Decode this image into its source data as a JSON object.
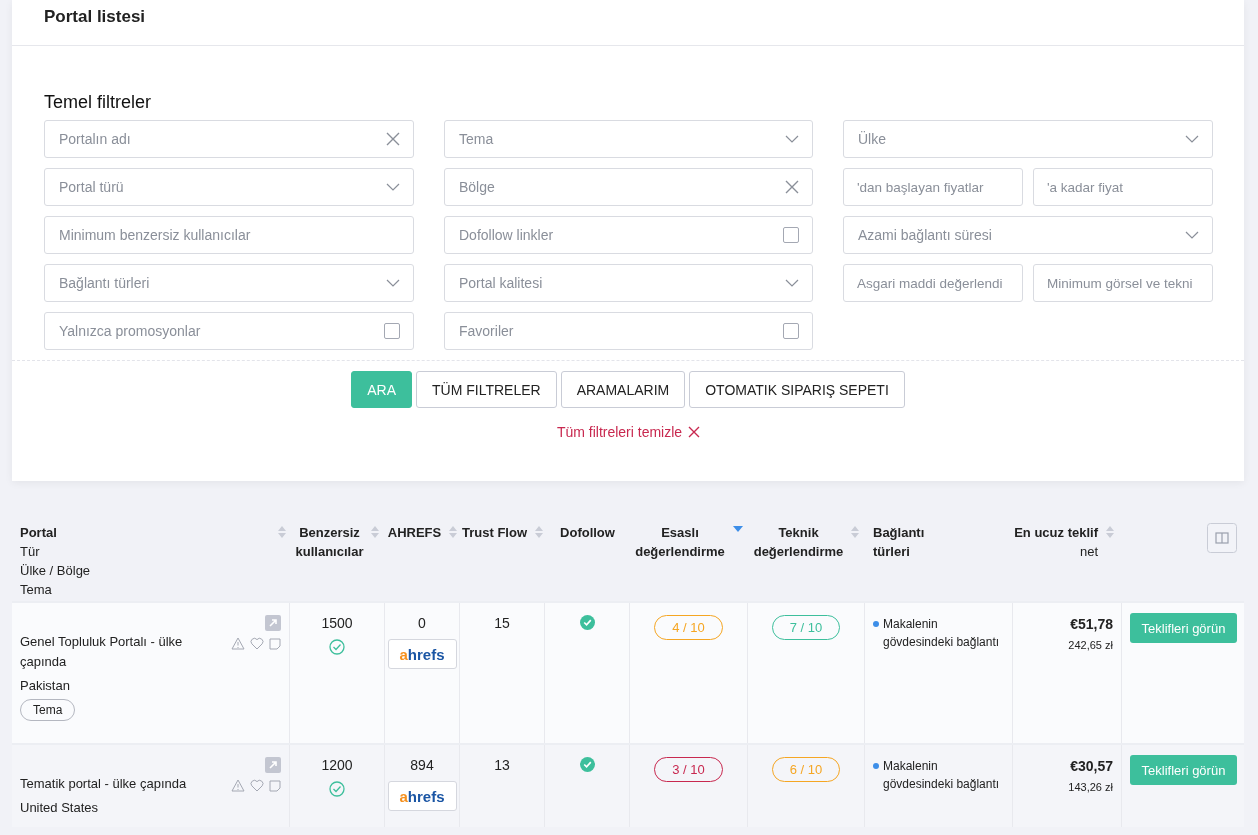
{
  "page_title": "Portal listesi",
  "filters": {
    "title": "Temel filtreler",
    "fields": [
      {
        "kind": "clear",
        "placeholder": "Portalın adı"
      },
      {
        "kind": "select",
        "placeholder": "Tema"
      },
      {
        "kind": "select",
        "placeholder": "Ülke"
      },
      {
        "kind": "select",
        "placeholder": "Portal türü"
      },
      {
        "kind": "clear",
        "placeholder": "Bölge"
      },
      {
        "kind": "pair",
        "fields": [
          {
            "placeholder": "'dan başlayan fiyatlar"
          },
          {
            "placeholder": "'a kadar fiyat"
          }
        ]
      },
      {
        "kind": "text",
        "placeholder": "Minimum benzersiz kullanıcılar"
      },
      {
        "kind": "check",
        "placeholder": "Dofollow linkler",
        "checked": false
      },
      {
        "kind": "select",
        "placeholder": "Azami bağlantı süresi"
      },
      {
        "kind": "select",
        "placeholder": "Bağlantı türleri"
      },
      {
        "kind": "select",
        "placeholder": "Portal kalitesi"
      },
      {
        "kind": "pair",
        "fields": [
          {
            "placeholder": "Asgari maddi değerlendi"
          },
          {
            "placeholder": "Minimum görsel ve tekni"
          }
        ]
      },
      {
        "kind": "check",
        "placeholder": "Yalnızca promosyonlar",
        "checked": false
      },
      {
        "kind": "check",
        "placeholder": "Favoriler",
        "checked": false
      }
    ],
    "buttons": [
      {
        "label": "ARA",
        "primary": true
      },
      {
        "label": "TÜM FILTRELER",
        "primary": false
      },
      {
        "label": "ARAMALARIM",
        "primary": false
      },
      {
        "label": "OTOMATIK SIPARIŞ SEPETI",
        "primary": false
      }
    ],
    "clear_link": "Tüm filtreleri temizle"
  },
  "table": {
    "columns": [
      {
        "lines": [
          "Portal",
          "Tür",
          "Ülke / Bölge",
          "Tema"
        ],
        "sortable": true,
        "sorted": false
      },
      {
        "lines": [
          "Benzersiz",
          "kullanıcılar"
        ],
        "sortable": true,
        "sorted": false
      },
      {
        "lines": [
          "AHREFS"
        ],
        "sortable": true,
        "sorted": false
      },
      {
        "lines": [
          "Trust Flow"
        ],
        "sortable": true,
        "sorted": false
      },
      {
        "lines": [
          "Dofollow"
        ],
        "sortable": false
      },
      {
        "lines": [
          "Esaslı",
          "değerlendirme"
        ],
        "sortable": true,
        "sorted": true
      },
      {
        "lines": [
          "Teknik",
          "değerlendirme"
        ],
        "sortable": true,
        "sorted": false
      },
      {
        "lines": [
          "Bağlantı",
          "türleri"
        ],
        "sortable": false
      },
      {
        "lines": [
          "En ucuz teklif",
          "net"
        ],
        "sortable": true,
        "sorted": false
      }
    ],
    "rows": [
      {
        "portal": "Genel Topluluk Portalı - ülke çapında",
        "country": "Pakistan",
        "tag": "Tema",
        "unique_users": "1500",
        "verified": true,
        "ahrefs": "0",
        "ahrefs_logo": "ahrefs",
        "trust_flow": "15",
        "dofollow": true,
        "scores": [
          {
            "text": "4 / 10",
            "color": "#f5a623"
          },
          {
            "text": "7 / 10",
            "color": "#3dbf9c"
          }
        ],
        "link_type": "Makalenin gövdesindeki bağlantı",
        "price": "€51,78",
        "price_local": "242,65 zł",
        "action": "Teklifleri görün"
      },
      {
        "portal": "Tematik portal - ülke çapında",
        "country": "United States",
        "unique_users": "1200",
        "verified": true,
        "ahrefs": "894",
        "ahrefs_logo": "ahrefs",
        "trust_flow": "13",
        "dofollow": true,
        "scores": [
          {
            "text": "3 / 10",
            "color": "#c8284f"
          },
          {
            "text": "6 / 10",
            "color": "#f5a623"
          }
        ],
        "link_type": "Makalenin gövdesindeki bağlantı",
        "price": "€30,57",
        "price_local": "143,26 zł",
        "action": "Teklifleri görün"
      }
    ]
  }
}
